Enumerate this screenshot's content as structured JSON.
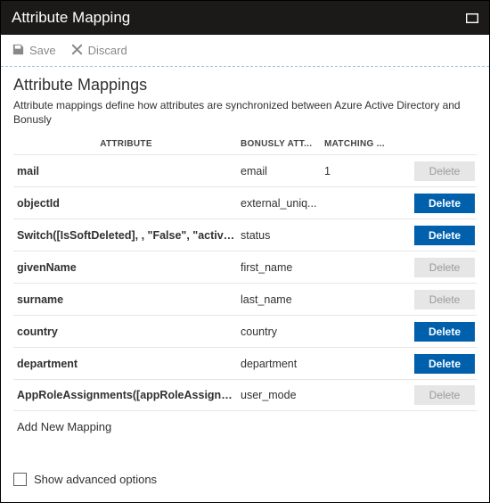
{
  "title": "Attribute Mapping",
  "toolbar": {
    "save": "Save",
    "discard": "Discard"
  },
  "section": {
    "heading": "Attribute Mappings",
    "description": "Attribute mappings define how attributes are synchronized between Azure Active Directory and Bonusly"
  },
  "columns": {
    "attribute": "ATTRIBUTE",
    "bonusly": "BONUSLY ATT...",
    "matching": "MATCHING ..."
  },
  "rows": [
    {
      "attribute": "mail",
      "bonusly": "email",
      "matching": "1",
      "delete_enabled": false
    },
    {
      "attribute": "objectId",
      "bonusly": "external_uniq...",
      "matching": "",
      "delete_enabled": true
    },
    {
      "attribute": "Switch([IsSoftDeleted], , \"False\", \"active\", \"True",
      "bonusly": "status",
      "matching": "",
      "delete_enabled": true
    },
    {
      "attribute": "givenName",
      "bonusly": "first_name",
      "matching": "",
      "delete_enabled": false
    },
    {
      "attribute": "surname",
      "bonusly": "last_name",
      "matching": "",
      "delete_enabled": false
    },
    {
      "attribute": "country",
      "bonusly": "country",
      "matching": "",
      "delete_enabled": true
    },
    {
      "attribute": "department",
      "bonusly": "department",
      "matching": "",
      "delete_enabled": true
    },
    {
      "attribute": "AppRoleAssignments([appRoleAssignments])",
      "bonusly": "user_mode",
      "matching": "",
      "delete_enabled": false
    }
  ],
  "buttons": {
    "delete": "Delete"
  },
  "addNew": "Add New Mapping",
  "advanced": "Show advanced options"
}
